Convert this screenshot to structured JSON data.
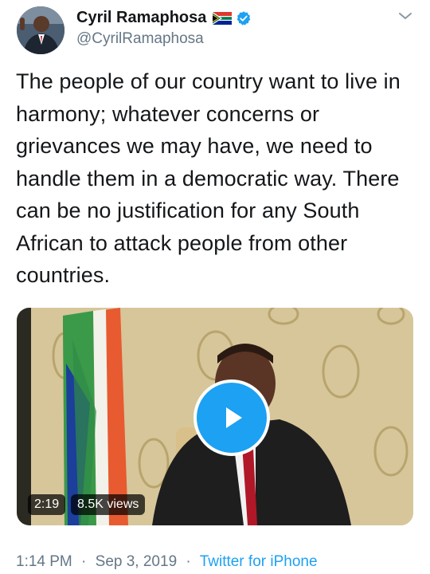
{
  "user": {
    "name": "Cyril Ramaphosa",
    "handle": "@CyrilRamaphosa",
    "flag_icon": "south-africa-flag-icon",
    "verified_icon": "verified-badge-icon"
  },
  "tweet": {
    "text": "The people of our country want to live in harmony; whatever concerns or grievances we may have, we need to handle them in a democratic way. There can be no justification for any South African to attack people from other countries."
  },
  "video": {
    "duration": "2:19",
    "views": "8.5K views",
    "play_icon": "play-icon"
  },
  "meta": {
    "time": "1:14 PM",
    "date": "Sep 3, 2019",
    "separator": "·",
    "source": "Twitter for iPhone"
  },
  "colors": {
    "accent": "#1da1f2",
    "secondary_text": "#657786",
    "primary_text": "#14171a"
  }
}
